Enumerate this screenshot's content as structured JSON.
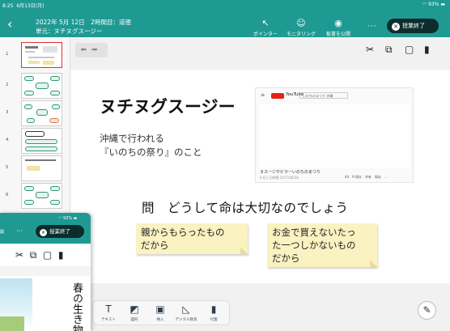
{
  "status_bar": {
    "time": "8:25",
    "date": "6月13日(月)",
    "battery": "93%"
  },
  "header": {
    "back_icon": "chevron-left-icon",
    "date_period": "2022年 5月 12日　2時間目：道徳",
    "unit": "単元：ヌチヌグスージー",
    "tools": [
      {
        "label": "ポインター",
        "icon": "pointer-icon"
      },
      {
        "label": "モニタリング",
        "icon": "monitoring-icon"
      },
      {
        "label": "板書を公開",
        "icon": "eye-icon"
      }
    ],
    "more": "···",
    "end_button": "授業終了"
  },
  "sidebar": {
    "slides": [
      "1",
      "2",
      "3",
      "4",
      "5",
      "6"
    ],
    "selected": "1"
  },
  "edit_tools": [
    "scissors-icon",
    "copy-icon",
    "paste-icon",
    "trash-icon"
  ],
  "slide": {
    "title": "ヌチヌグスージー",
    "subtext_line1": "沖縄で行われる",
    "subtext_line2": "『いのちの祭り』のこと",
    "video": {
      "site": "YouTube",
      "search": "いのちのまつり 沖縄",
      "caption": "ヌスージやビラーいのちのまつり",
      "meta": "6.6万 回視聴 2017/06/28",
      "actions": "44　9 保存　共有　保存　..."
    },
    "question": "問　どうして命は大切なのでしょう",
    "notes": [
      {
        "line1": "親からもらったもの",
        "line2": "だから",
        "line3": ""
      },
      {
        "line1": "お金で買えないたっ",
        "line2": "た一つしかないもの",
        "line3": "だから"
      }
    ]
  },
  "bottom_toolbar": [
    {
      "label": "テキスト",
      "icon": "text-icon"
    },
    {
      "label": "図形",
      "icon": "shape-icon"
    },
    {
      "label": "挿入",
      "icon": "image-icon"
    },
    {
      "label": "デジタル教具",
      "icon": "ruler-icon"
    },
    {
      "label": "付箋",
      "icon": "bookmark-icon"
    }
  ],
  "pen_button": "pen-icon",
  "overlay_window": {
    "battery": "93%",
    "side_label": "開",
    "more": "···",
    "end_button": "授業終了",
    "vertical_text": "春の生き物"
  }
}
